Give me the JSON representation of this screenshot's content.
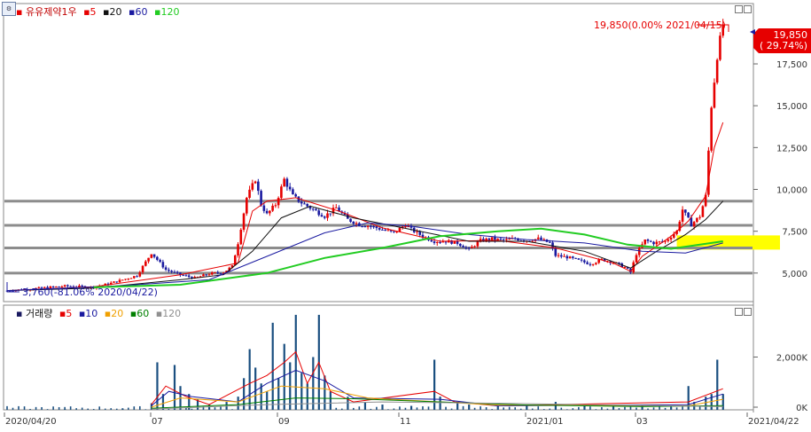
{
  "price_panel": {
    "legend": {
      "title": "유유제약1우",
      "ma": [
        {
          "label": "5",
          "color": "#e60000"
        },
        {
          "label": "20",
          "color": "#111111"
        },
        {
          "label": "60",
          "color": "#1a1aa0"
        },
        {
          "label": "120",
          "color": "#22cc22"
        }
      ]
    },
    "annotations": {
      "high": "19,850(0.00% 2021/04/15)",
      "low": "3,760(-81.06% 2020/04/22)"
    },
    "current_price": {
      "value": "19,850",
      "change": "( 29.74%)"
    }
  },
  "volume_panel": {
    "legend": {
      "title": "거래량",
      "ma": [
        {
          "label": "5",
          "color": "#e60000"
        },
        {
          "label": "10",
          "color": "#1a1aa0"
        },
        {
          "label": "20",
          "color": "#f0a000"
        },
        {
          "label": "60",
          "color": "#008000"
        },
        {
          "label": "120",
          "color": "#909090"
        }
      ]
    }
  },
  "corner_icon": "chart-settings-icon",
  "colors": {
    "up": "#e60000",
    "down": "#1a1aa0",
    "ma5": "#e60000",
    "ma20": "#111111",
    "ma60": "#1a1aa0",
    "ma120": "#22cc22",
    "support_lines": "#8c8c8c",
    "highlight": "#ffff00"
  },
  "chart_data": [
    {
      "type": "candlestick",
      "ylim": [
        3400,
        21000
      ],
      "y_ticks": [
        "5,000",
        "7,500",
        "10,000",
        "12,500",
        "15,000",
        "17,500"
      ],
      "x_ticks": [
        "2020/04/20",
        "07",
        "09",
        "11",
        "2021/01",
        "03",
        "2021/04/22"
      ],
      "horizontal_levels": [
        9300,
        7850,
        6500,
        5000
      ],
      "highlight_zone": [
        6400,
        7250
      ],
      "series": [
        {
          "name": "price",
          "points": [
            [
              0,
              3950
            ],
            [
              10,
              4080
            ],
            [
              20,
              4220
            ],
            [
              30,
              4160
            ],
            [
              35,
              4350
            ],
            [
              45,
              4850
            ],
            [
              50,
              6200
            ],
            [
              55,
              5200
            ],
            [
              60,
              4900
            ],
            [
              65,
              4700
            ],
            [
              70,
              4950
            ],
            [
              75,
              5050
            ],
            [
              78,
              5400
            ],
            [
              80,
              6800
            ],
            [
              83,
              9500
            ],
            [
              86,
              10600
            ],
            [
              88,
              9100
            ],
            [
              90,
              8500
            ],
            [
              93,
              9100
            ],
            [
              96,
              10600
            ],
            [
              99,
              9600
            ],
            [
              102,
              9200
            ],
            [
              106,
              8800
            ],
            [
              110,
              8400
            ],
            [
              114,
              8900
            ],
            [
              118,
              8200
            ],
            [
              122,
              7900
            ],
            [
              126,
              7800
            ],
            [
              130,
              7600
            ],
            [
              134,
              7400
            ],
            [
              138,
              7900
            ],
            [
              140,
              7600
            ],
            [
              144,
              7200
            ],
            [
              148,
              6900
            ],
            [
              152,
              6900
            ],
            [
              156,
              6800
            ],
            [
              160,
              6400
            ],
            [
              164,
              6950
            ],
            [
              168,
              7050
            ],
            [
              172,
              6950
            ],
            [
              176,
              7050
            ],
            [
              180,
              6950
            ],
            [
              184,
              7050
            ],
            [
              188,
              6800
            ],
            [
              190,
              6050
            ],
            [
              194,
              5950
            ],
            [
              198,
              5750
            ],
            [
              202,
              5550
            ],
            [
              206,
              5800
            ],
            [
              210,
              5650
            ],
            [
              214,
              5350
            ],
            [
              216,
              5050
            ],
            [
              218,
              6150
            ],
            [
              221,
              6950
            ],
            [
              224,
              6800
            ],
            [
              228,
              6900
            ],
            [
              232,
              7500
            ],
            [
              234,
              8800
            ],
            [
              237,
              7900
            ],
            [
              240,
              8400
            ],
            [
              242,
              9600
            ],
            [
              244,
              15000
            ],
            [
              246,
              18000
            ],
            [
              248,
              19850
            ]
          ]
        },
        {
          "name": "5",
          "points": [
            [
              0,
              3950
            ],
            [
              30,
              4180
            ],
            [
              60,
              4900
            ],
            [
              80,
              5600
            ],
            [
              85,
              8700
            ],
            [
              90,
              9300
            ],
            [
              100,
              9500
            ],
            [
              115,
              8700
            ],
            [
              130,
              7700
            ],
            [
              150,
              6900
            ],
            [
              170,
              6950
            ],
            [
              190,
              6500
            ],
            [
              210,
              5600
            ],
            [
              216,
              5100
            ],
            [
              220,
              6000
            ],
            [
              230,
              7200
            ],
            [
              236,
              8100
            ],
            [
              242,
              9600
            ],
            [
              245,
              12500
            ],
            [
              248,
              14000
            ]
          ]
        },
        {
          "name": "20",
          "points": [
            [
              0,
              3950
            ],
            [
              30,
              4100
            ],
            [
              60,
              4600
            ],
            [
              75,
              4900
            ],
            [
              85,
              6300
            ],
            [
              95,
              8300
            ],
            [
              105,
              9000
            ],
            [
              120,
              8300
            ],
            [
              140,
              7600
            ],
            [
              160,
              6900
            ],
            [
              180,
              6900
            ],
            [
              200,
              6300
            ],
            [
              216,
              5300
            ],
            [
              225,
              6300
            ],
            [
              235,
              7300
            ],
            [
              242,
              8200
            ],
            [
              248,
              9300
            ]
          ]
        },
        {
          "name": "60",
          "points": [
            [
              0,
              3950
            ],
            [
              40,
              4250
            ],
            [
              70,
              4600
            ],
            [
              90,
              6000
            ],
            [
              110,
              7400
            ],
            [
              125,
              8000
            ],
            [
              140,
              7800
            ],
            [
              160,
              7300
            ],
            [
              180,
              7000
            ],
            [
              200,
              6800
            ],
            [
              220,
              6300
            ],
            [
              235,
              6200
            ],
            [
              248,
              6800
            ]
          ]
        },
        {
          "name": "120",
          "points": [
            [
              30,
              4150
            ],
            [
              60,
              4300
            ],
            [
              90,
              5000
            ],
            [
              110,
              5900
            ],
            [
              130,
              6500
            ],
            [
              150,
              7200
            ],
            [
              170,
              7500
            ],
            [
              185,
              7650
            ],
            [
              200,
              7300
            ],
            [
              215,
              6700
            ],
            [
              230,
              6450
            ],
            [
              248,
              6900
            ]
          ]
        }
      ]
    },
    {
      "type": "bar",
      "ylim": [
        0,
        3900000
      ],
      "y_ticks": [
        "0K",
        "2,000K"
      ],
      "series": [
        {
          "name": "volume",
          "values": [
            [
              20,
              30000
            ],
            [
              40,
              50000
            ],
            [
              50,
              250000
            ],
            [
              52,
              1800000
            ],
            [
              54,
              600000
            ],
            [
              58,
              1700000
            ],
            [
              60,
              900000
            ],
            [
              63,
              600000
            ],
            [
              66,
              400000
            ],
            [
              70,
              200000
            ],
            [
              76,
              300000
            ],
            [
              80,
              500000
            ],
            [
              82,
              1200000
            ],
            [
              84,
              2300000
            ],
            [
              86,
              1600000
            ],
            [
              88,
              1000000
            ],
            [
              90,
              700000
            ],
            [
              92,
              3300000
            ],
            [
              94,
              1200000
            ],
            [
              96,
              2500000
            ],
            [
              98,
              1800000
            ],
            [
              100,
              3600000
            ],
            [
              102,
              1400000
            ],
            [
              104,
              1000000
            ],
            [
              106,
              2000000
            ],
            [
              108,
              3600000
            ],
            [
              110,
              1300000
            ],
            [
              112,
              700000
            ],
            [
              118,
              500000
            ],
            [
              124,
              300000
            ],
            [
              130,
              200000
            ],
            [
              140,
              150000
            ],
            [
              148,
              1900000
            ],
            [
              150,
              500000
            ],
            [
              156,
              300000
            ],
            [
              160,
              200000
            ],
            [
              170,
              150000
            ],
            [
              180,
              150000
            ],
            [
              190,
              300000
            ],
            [
              200,
              200000
            ],
            [
              210,
              150000
            ],
            [
              220,
              150000
            ],
            [
              230,
              100000
            ],
            [
              236,
              900000
            ],
            [
              238,
              300000
            ],
            [
              242,
              500000
            ],
            [
              244,
              600000
            ],
            [
              246,
              1900000
            ],
            [
              248,
              600000
            ]
          ]
        },
        {
          "name": "5",
          "points": [
            [
              50,
              200000
            ],
            [
              55,
              900000
            ],
            [
              62,
              500000
            ],
            [
              70,
              200000
            ],
            [
              84,
              1000000
            ],
            [
              90,
              1300000
            ],
            [
              96,
              1800000
            ],
            [
              100,
              2200000
            ],
            [
              104,
              1000000
            ],
            [
              108,
              1800000
            ],
            [
              112,
              700000
            ],
            [
              120,
              300000
            ],
            [
              148,
              700000
            ],
            [
              155,
              300000
            ],
            [
              170,
              150000
            ],
            [
              236,
              300000
            ],
            [
              248,
              800000
            ]
          ]
        },
        {
          "name": "10",
          "points": [
            [
              50,
              150000
            ],
            [
              56,
              700000
            ],
            [
              64,
              500000
            ],
            [
              80,
              300000
            ],
            [
              90,
              1000000
            ],
            [
              100,
              1500000
            ],
            [
              110,
              1100000
            ],
            [
              120,
              450000
            ],
            [
              150,
              400000
            ],
            [
              170,
              150000
            ],
            [
              236,
              200000
            ],
            [
              248,
              600000
            ]
          ]
        },
        {
          "name": "20",
          "points": [
            [
              50,
              100000
            ],
            [
              60,
              450000
            ],
            [
              80,
              300000
            ],
            [
              95,
              900000
            ],
            [
              110,
              800000
            ],
            [
              125,
              450000
            ],
            [
              150,
              300000
            ],
            [
              170,
              180000
            ],
            [
              236,
              150000
            ],
            [
              248,
              400000
            ]
          ]
        },
        {
          "name": "60",
          "points": [
            [
              50,
              60000
            ],
            [
              80,
              200000
            ],
            [
              100,
              450000
            ],
            [
              120,
              420000
            ],
            [
              150,
              300000
            ],
            [
              180,
              180000
            ],
            [
              220,
              120000
            ],
            [
              248,
              160000
            ]
          ]
        },
        {
          "name": "120",
          "points": [
            [
              50,
              30000
            ],
            [
              90,
              200000
            ],
            [
              130,
              300000
            ],
            [
              170,
              250000
            ],
            [
              210,
              180000
            ],
            [
              248,
              120000
            ]
          ]
        }
      ]
    }
  ]
}
